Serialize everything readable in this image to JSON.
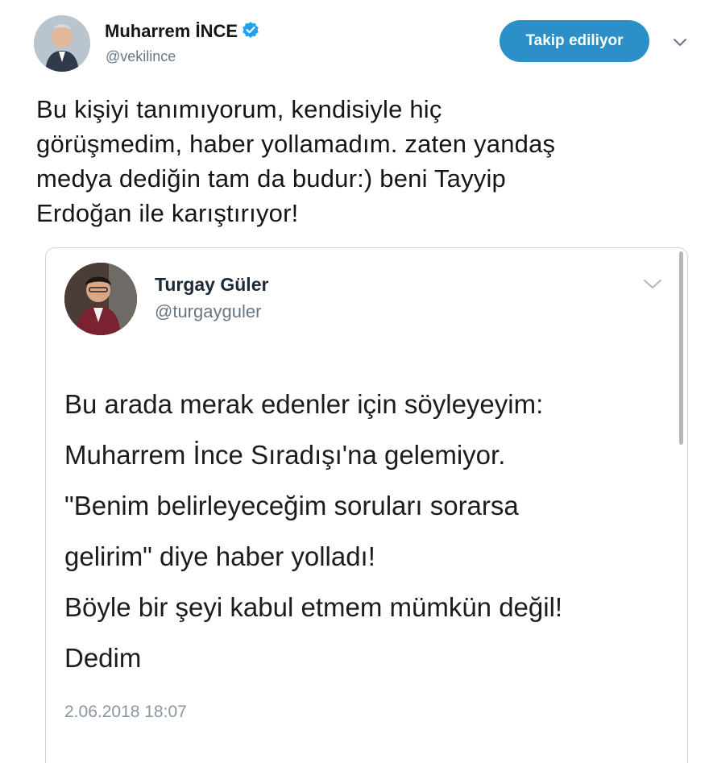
{
  "tweet": {
    "display_name": "Muharrem İNCE",
    "handle": "@vekilince",
    "follow_label": "Takip ediliyor",
    "text_lines": [
      "Bu kişiyi tanımıyorum, kendisiyle hiç",
      "görüşmedim, haber yollamadım. zaten yandaş",
      "medya dediğin tam da budur:) beni Tayyip",
      "Erdoğan ile karıştırıyor!"
    ]
  },
  "quoted": {
    "display_name": "Turgay Güler",
    "handle": "@turgayguler",
    "text_lines": [
      "Bu arada merak edenler için söyleyeyim:",
      "Muharrem İnce Sıradışı'na gelemiyor.",
      "\"Benim belirleyeceğim soruları sorarsa",
      "gelirim\" diye haber yolladı!",
      "Böyle bir şeyi kabul etmem mümkün değil!",
      "Dedim"
    ],
    "date": "2.06.2018 18:07"
  },
  "icons": {
    "verified": "verified-badge-icon",
    "menu": "chevron-down-icon"
  },
  "colors": {
    "accent": "#2c8fc8",
    "verified": "#1da1f2",
    "secondary_text": "#657786",
    "border": "#cdd6dd"
  }
}
